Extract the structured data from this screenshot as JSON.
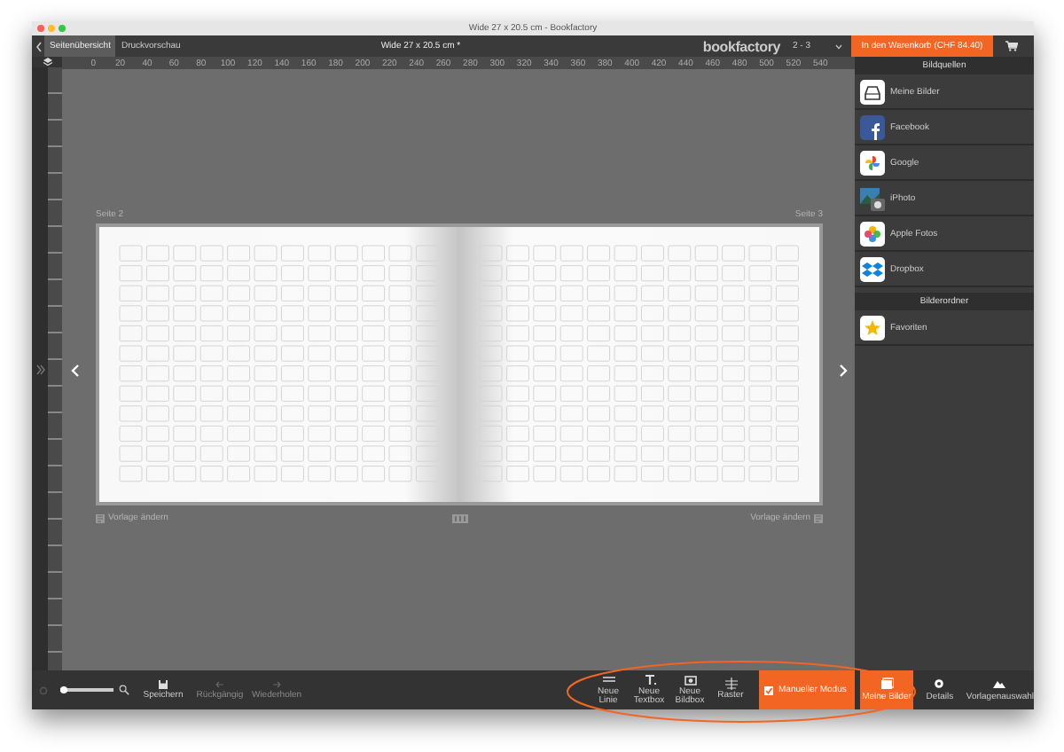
{
  "window": {
    "title": "Wide 27 x 20.5 cm - Bookfactory"
  },
  "toolbar": {
    "tabs": [
      {
        "label": "Seitenübersicht",
        "selected": true
      },
      {
        "label": "Druckvorschau",
        "selected": false
      }
    ],
    "document_title": "Wide 27 x 20.5 cm *",
    "logo": "bookfactory",
    "page_range": "2 - 3",
    "cart_button": "In den Warenkorb (CHF 84.40)"
  },
  "ruler": {
    "labels": [
      "0",
      "20",
      "40",
      "60",
      "80",
      "100",
      "120",
      "140",
      "160",
      "180",
      "200",
      "220",
      "240",
      "260",
      "280",
      "300",
      "320",
      "340",
      "360",
      "380",
      "400",
      "420",
      "440",
      "460",
      "480",
      "500",
      "520",
      "540"
    ]
  },
  "spread": {
    "pages": [
      {
        "label": "Seite 2",
        "template_link": "Vorlage ändern"
      },
      {
        "label": "Seite 3",
        "template_link": "Vorlage ändern"
      }
    ]
  },
  "sidebar": {
    "sections": [
      {
        "title": "Bildquellen",
        "items": [
          {
            "label": "Meine Bilder",
            "kind": "drive"
          },
          {
            "label": "Facebook",
            "kind": "facebook"
          },
          {
            "label": "Google",
            "kind": "pinwheel"
          },
          {
            "label": "iPhoto",
            "kind": "photo"
          },
          {
            "label": "Apple Fotos",
            "kind": "flower"
          },
          {
            "label": "Dropbox",
            "kind": "dropbox"
          }
        ]
      },
      {
        "title": "Bilderordner",
        "items": [
          {
            "label": "Favoriten",
            "kind": "star"
          }
        ]
      }
    ]
  },
  "bottom_bar": {
    "zoom": {
      "level": 0.05
    },
    "actions": [
      {
        "label": "Speichern",
        "kind": "save",
        "disabled": false
      },
      {
        "label": "Rückgängig",
        "kind": "undo",
        "disabled": true
      },
      {
        "label": "Wiederholen",
        "kind": "redo",
        "disabled": true
      }
    ],
    "tools": [
      {
        "label": "Neue Linie",
        "kind": "line"
      },
      {
        "label": "Neue Textbox",
        "kind": "text"
      },
      {
        "label": "Neue Bildbox",
        "kind": "image"
      },
      {
        "label": "Raster",
        "kind": "grid"
      }
    ],
    "manual_mode": {
      "label": "Manueller Modus",
      "checked": true
    },
    "panel_tabs": [
      {
        "label": "Meine Bilder",
        "kind": "images",
        "selected": true
      },
      {
        "label": "Details",
        "kind": "gear",
        "selected": false
      },
      {
        "label": "Vorlagenauswahl",
        "kind": "layout",
        "selected": false
      }
    ]
  }
}
